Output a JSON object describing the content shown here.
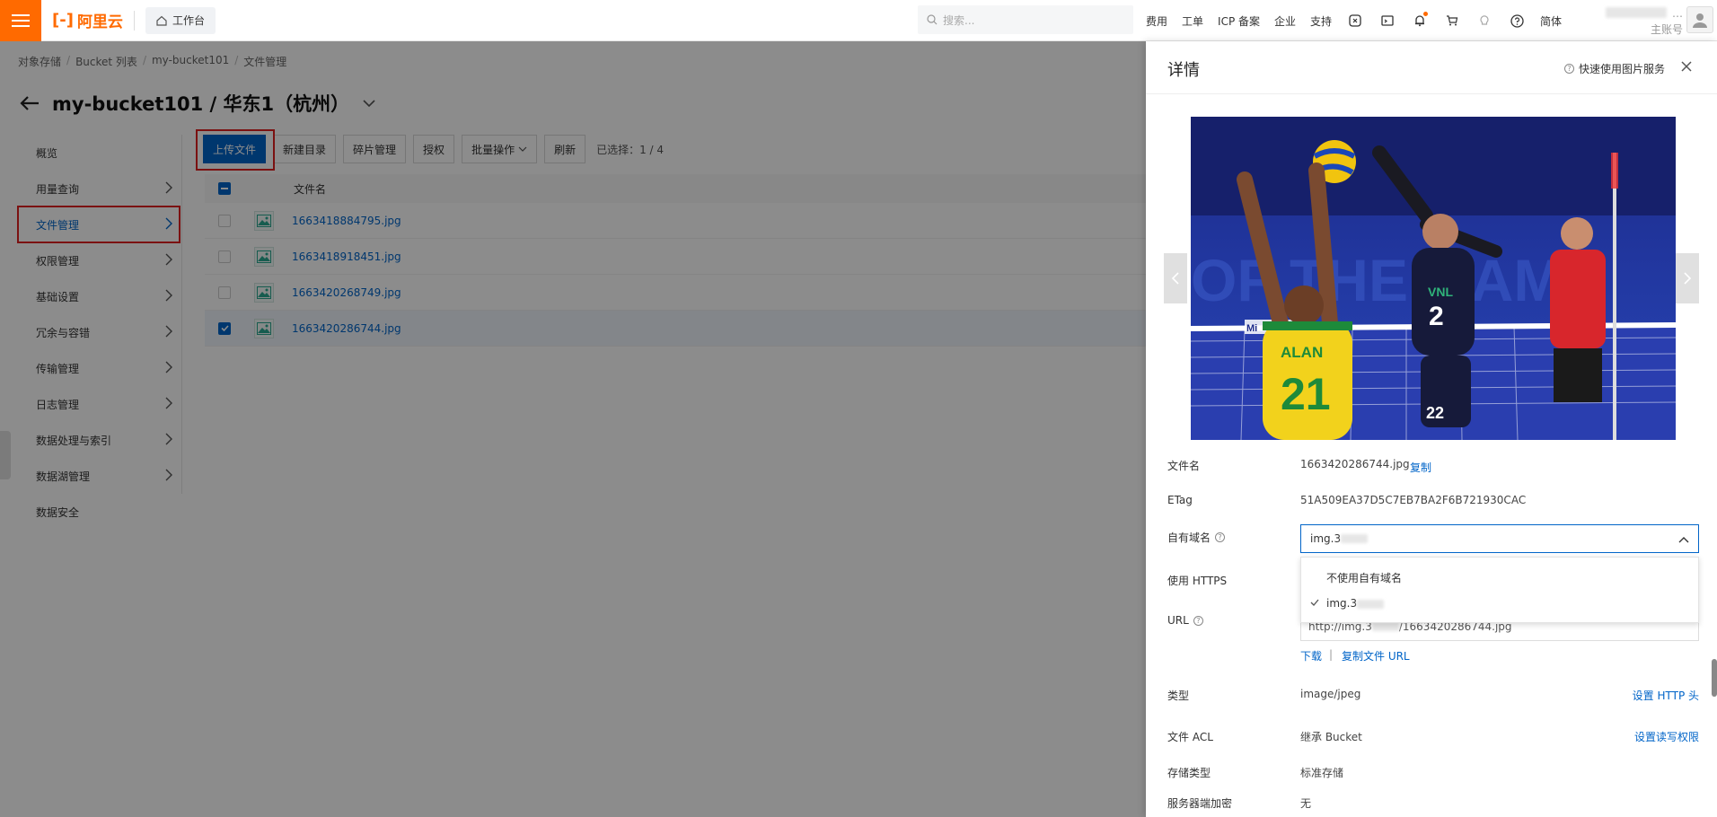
{
  "topbar": {
    "logo_text": "阿里云",
    "logo_mark": "[-]",
    "workbench": "工作台",
    "search_placeholder": "搜索...",
    "nav": [
      "费用",
      "工单",
      "ICP 备案",
      "企业",
      "支持"
    ],
    "lang": "简体",
    "account_name": "…",
    "account_sub": "主账号"
  },
  "breadcrumb": [
    "对象存储",
    "Bucket 列表",
    "my-bucket101",
    "文件管理"
  ],
  "breadcrumb_sep": "/",
  "page": {
    "title": "my-bucket101 / 华东1（杭州）"
  },
  "sidebar": {
    "items": [
      {
        "label": "概览"
      },
      {
        "label": "用量查询"
      },
      {
        "label": "文件管理"
      },
      {
        "label": "权限管理"
      },
      {
        "label": "基础设置"
      },
      {
        "label": "冗余与容错"
      },
      {
        "label": "传输管理"
      },
      {
        "label": "日志管理"
      },
      {
        "label": "数据处理与索引"
      },
      {
        "label": "数据湖管理"
      },
      {
        "label": "数据安全"
      }
    ]
  },
  "toolbar": {
    "upload": "上传文件",
    "new_dir": "新建目录",
    "fragments": "碎片管理",
    "authorize": "授权",
    "batch": "批量操作",
    "refresh": "刷新",
    "selected": "已选择：1 / 4"
  },
  "table": {
    "header_name": "文件名",
    "rows": [
      {
        "name": "1663418884795.jpg",
        "checked": false
      },
      {
        "name": "1663418918451.jpg",
        "checked": false
      },
      {
        "name": "1663420268749.jpg",
        "checked": false
      },
      {
        "name": "1663420286744.jpg",
        "checked": true
      }
    ]
  },
  "panel": {
    "title": "详情",
    "help_link": "快速使用图片服务",
    "image": {
      "banner_text": "OF THE GAME",
      "left_jersey_name": "ALAN",
      "left_jersey_number": "21",
      "right_jersey_number": "22",
      "mid_jersey_number": "2",
      "jersey_mark": "VNL",
      "net_text": "Mi"
    },
    "fields": {
      "filename_label": "文件名",
      "filename_value": "1663420286744.jpg",
      "copy": "复制",
      "etag_label": "ETag",
      "etag_value": "51A509EA37D5C7EB7BA2F6B721930CAC",
      "domain_label": "自有域名",
      "domain_value": "img.3",
      "https_label": "使用 HTTPS",
      "url_label": "URL",
      "url_prefix": "http://img.3",
      "url_suffix": "/1663420286744.jpg",
      "download": "下载",
      "link_sep": "|",
      "copy_url": "复制文件 URL",
      "type_label": "类型",
      "type_value": "image/jpeg",
      "set_http_header": "设置 HTTP 头",
      "acl_label": "文件 ACL",
      "acl_value": "继承 Bucket",
      "set_acl": "设置读写权限",
      "storage_label": "存储类型",
      "storage_value": "标准存储",
      "encrypt_label": "服务器端加密",
      "encrypt_value": "无"
    },
    "dropdown": {
      "options": [
        "不使用自有域名",
        "img.3"
      ],
      "selected_index": 1
    }
  },
  "colors": {
    "brand": "#ff6a00",
    "primary": "#0064c8",
    "highlight": "#e02020"
  }
}
